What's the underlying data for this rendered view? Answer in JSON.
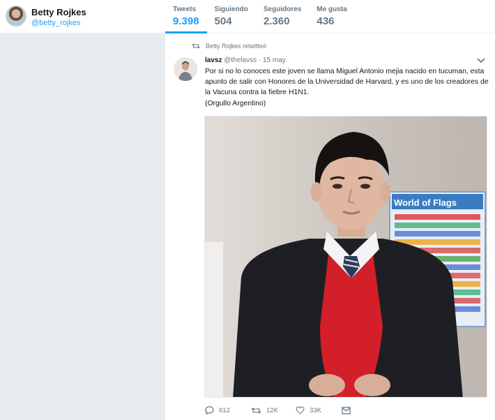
{
  "profile": {
    "name": "Betty Rojkes",
    "handle": "@betty_rojkes"
  },
  "stats": [
    {
      "label": "Tweets",
      "value": "9.398"
    },
    {
      "label": "Siguiendo",
      "value": "504"
    },
    {
      "label": "Seguidores",
      "value": "2.360"
    },
    {
      "label": "Me gusta",
      "value": "436"
    }
  ],
  "tweet": {
    "retweet_notice": "Betty Rojkes retwitteó",
    "author_name": "lavsz",
    "author_handle": "@thelavss",
    "dot": "·",
    "time": "15 may.",
    "text": "Por si no lo conoces este joven se llama Miguel Antonio mejia nacido en tucuman, esta apunto de salir con Honores de la Universidad de Harvard, y es uno de los creadores de la Vacuna contra la fiebre H1N1.",
    "text_line2": "(Orgullo Argentino)",
    "poster_text": "World of Flags",
    "actions": {
      "replies": "612",
      "retweets": "12K",
      "likes": "33K"
    }
  },
  "colors": {
    "accent": "#1da1f2",
    "muted": "#657786",
    "background": "#e6ecf0"
  },
  "icons": [
    "retweet-icon",
    "caret-down-icon",
    "reply-icon",
    "like-icon",
    "direct-message-icon"
  ]
}
